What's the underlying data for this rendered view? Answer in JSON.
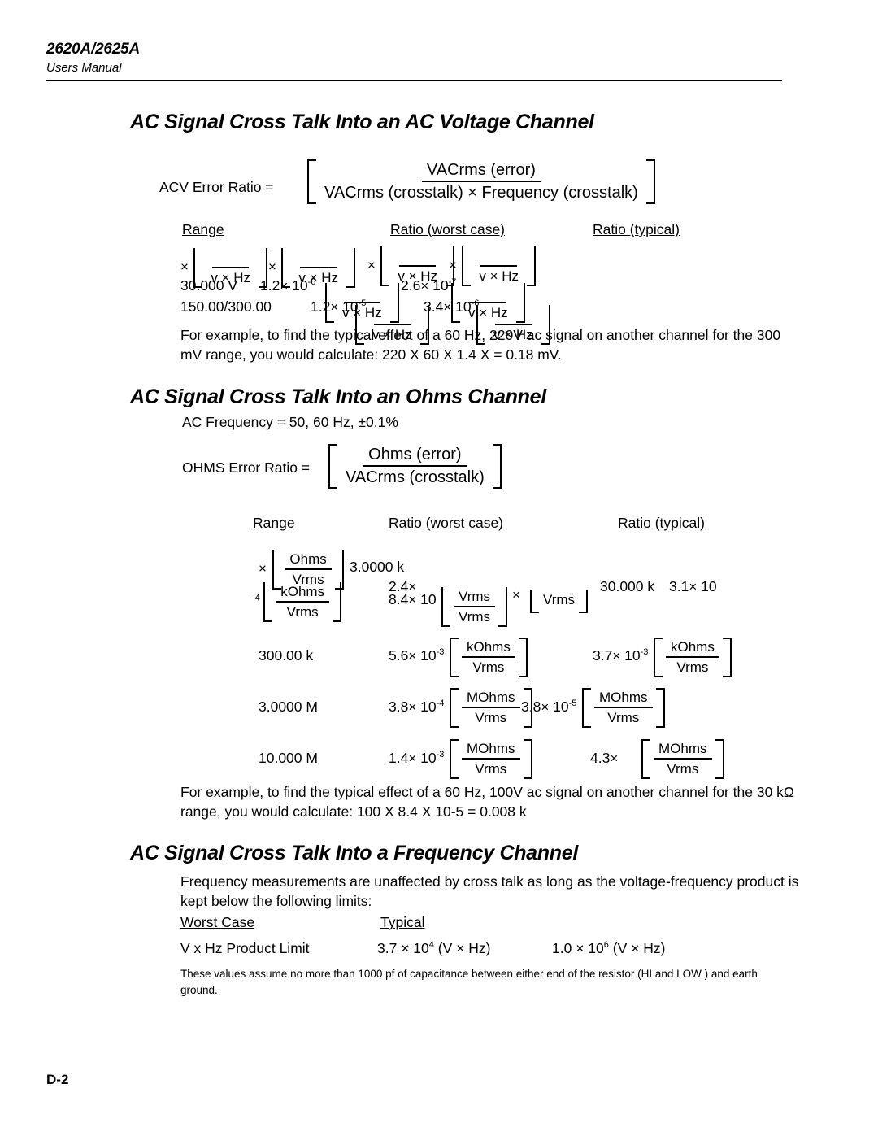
{
  "header": {
    "model": "2620A/2625A",
    "manual": "Users Manual"
  },
  "page_number": "D-2",
  "sections": [
    {
      "heading": "AC Signal Cross Talk Into an AC Voltage Channel",
      "formula": {
        "label": "ACV Error Ratio =",
        "numerator": "VACrms (error)",
        "denominator": "VACrms (crosstalk) ×  Frequency (crosstalk)"
      },
      "table": {
        "columns": [
          "Range",
          "Ratio (worst case)",
          "Ratio (typical)"
        ],
        "unit": "v × Hz",
        "rows": [
          {
            "range": "30.000 V",
            "worst_mantissa": "1.2",
            "worst_exp": "-6",
            "typical_mantissa": "2.6",
            "typical_exp": "-7"
          },
          {
            "range": "150.00/300.00",
            "worst_mantissa": "1.2",
            "worst_exp": "-5",
            "typical_mantissa": "3.4",
            "typical_exp": "-6"
          }
        ]
      },
      "example": "For example, to find the typical effect of a 60 Hz, 220V ac signal on another channel for the 300 mV range, you would calculate: 220 X 60 X 1.4 X = 0.18 mV."
    },
    {
      "heading": "AC Signal Cross Talk Into an Ohms Channel",
      "frequency_note": "AC Frequency = 50, 60 Hz, ±0.1%",
      "formula": {
        "label": "OHMS Error Ratio =",
        "numerator": "Ohms (error)",
        "denominator": "VACrms (crosstalk)"
      },
      "table": {
        "columns": [
          "Range",
          "Ratio (worst case)",
          "Ratio (typical)"
        ],
        "rows": [
          {
            "range": "3.0000 k",
            "worst_mantissa": "2.4",
            "worst_exp": "",
            "worst_unit": "Ohms",
            "typical_mantissa": "",
            "typical_exp": "",
            "typical_unit": "Vrms"
          },
          {
            "range": "30.000 k",
            "worst_mantissa": "8.4",
            "worst_exp": "-4",
            "worst_unit": "kOhms",
            "typical_mantissa": "3.1",
            "typical_exp": "",
            "typical_unit": "Vrms"
          },
          {
            "range": "300.00 k",
            "worst_mantissa": "5.6",
            "worst_exp": "-3",
            "worst_unit": "kOhms",
            "typical_mantissa": "3.7",
            "typical_exp": "-3",
            "typical_unit": "kOhms"
          },
          {
            "range": "3.0000 M",
            "worst_mantissa": "3.8",
            "worst_exp": "-4",
            "worst_unit": "MOhms",
            "typical_mantissa": "3.8",
            "typical_exp": "-5",
            "typical_unit": "MOhms"
          },
          {
            "range": "10.000 M",
            "worst_mantissa": "1.4",
            "worst_exp": "-3",
            "worst_unit": "MOhms",
            "typical_mantissa": "4.3",
            "typical_exp": "",
            "typical_unit": "MOhms"
          }
        ],
        "denominator_unit": "Vrms"
      },
      "example": "For example, to find the typical effect of a 60 Hz, 100V ac signal on another channel for the 30 kΩ range, you would calculate: 100 X 8.4 X 10-5 = 0.008 k"
    },
    {
      "heading": "AC Signal Cross Talk Into a Frequency Channel",
      "intro": "Frequency measurements are unaffected by cross talk as long as the voltage-frequency product is kept below the following limits:",
      "table": {
        "columns": [
          "Worst Case",
          "Typical"
        ],
        "row_label": "V x Hz Product Limit",
        "worst_case": "3.7 ×  10",
        "worst_case_exp": "4",
        "worst_case_unit": "(V ×  Hz)",
        "typical": "1.0 ×  10",
        "typical_exp": "6",
        "typical_unit": "(V ×  Hz)"
      },
      "footnote": "These values assume no more than 1000 pf of capacitance between either end of the resistor (HI and LOW ) and earth ground."
    }
  ]
}
